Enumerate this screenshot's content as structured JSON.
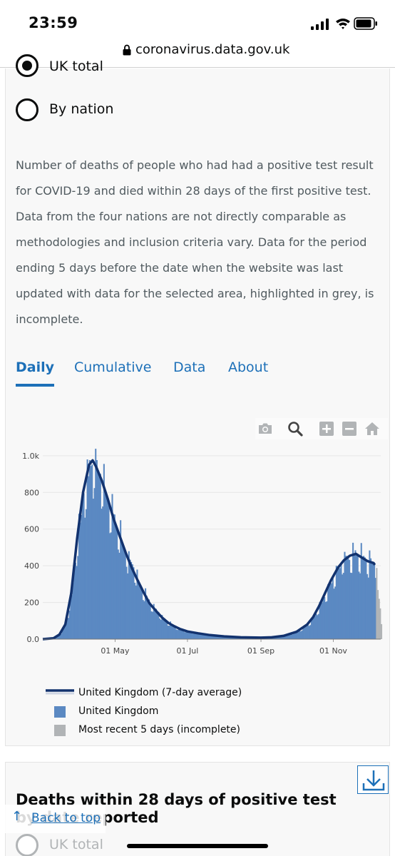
{
  "status_bar": {
    "time": "23:59"
  },
  "url_bar": {
    "url": "coronavirus.data.gov.uk"
  },
  "area_options": [
    {
      "label": "UK total",
      "checked": true
    },
    {
      "label": "By nation",
      "checked": false
    }
  ],
  "description": "Number of deaths of people who had had a positive test result for COVID-19 and died within 28 days of the first positive test. Data from the four nations are not directly comparable as methodologies and inclusion criteria vary. Data for the period ending 5 days before the date when the website was last updated with data for the selected area, highlighted in grey, is incomplete.",
  "tabs": [
    {
      "label": "Daily",
      "active": true
    },
    {
      "label": "Cumulative",
      "active": false
    },
    {
      "label": "Data",
      "active": false
    },
    {
      "label": "About",
      "active": false
    }
  ],
  "chart_toolbar": [
    "camera-icon",
    "zoom-icon",
    "zoom-in-icon",
    "zoom-out-icon",
    "home-icon"
  ],
  "chart_data": {
    "type": "bar",
    "title": "",
    "xlabel": "",
    "ylabel": "",
    "x_range": [
      "2020-03-01",
      "2020-12-11"
    ],
    "ylim": [
      0,
      1050
    ],
    "yticks": [
      "0.0",
      "200",
      "400",
      "600",
      "800",
      "1.0k"
    ],
    "xticks": [
      "01 May",
      "01 Jul",
      "01 Sep",
      "01 Nov"
    ],
    "grid": true,
    "legend_position": "bottom-left",
    "colors": {
      "average": "#12326e",
      "daily": "#5b89c2",
      "incomplete": "#b1b4b6"
    },
    "series": [
      {
        "name": "United Kingdom (7-day average)",
        "type": "line",
        "points": [
          [
            "2020-03-01",
            0
          ],
          [
            "2020-03-10",
            5
          ],
          [
            "2020-03-15",
            25
          ],
          [
            "2020-03-20",
            80
          ],
          [
            "2020-03-25",
            250
          ],
          [
            "2020-03-30",
            550
          ],
          [
            "2020-04-04",
            800
          ],
          [
            "2020-04-09",
            950
          ],
          [
            "2020-04-12",
            975
          ],
          [
            "2020-04-15",
            940
          ],
          [
            "2020-04-20",
            860
          ],
          [
            "2020-04-25",
            760
          ],
          [
            "2020-04-30",
            650
          ],
          [
            "2020-05-05",
            560
          ],
          [
            "2020-05-10",
            470
          ],
          [
            "2020-05-15",
            390
          ],
          [
            "2020-05-20",
            320
          ],
          [
            "2020-05-25",
            255
          ],
          [
            "2020-05-30",
            195
          ],
          [
            "2020-06-05",
            150
          ],
          [
            "2020-06-10",
            115
          ],
          [
            "2020-06-15",
            88
          ],
          [
            "2020-06-20",
            70
          ],
          [
            "2020-06-25",
            55
          ],
          [
            "2020-07-01",
            42
          ],
          [
            "2020-07-10",
            32
          ],
          [
            "2020-07-20",
            22
          ],
          [
            "2020-08-01",
            15
          ],
          [
            "2020-08-15",
            10
          ],
          [
            "2020-09-01",
            8
          ],
          [
            "2020-09-10",
            10
          ],
          [
            "2020-09-20",
            18
          ],
          [
            "2020-10-01",
            40
          ],
          [
            "2020-10-10",
            80
          ],
          [
            "2020-10-15",
            120
          ],
          [
            "2020-10-20",
            180
          ],
          [
            "2020-10-25",
            250
          ],
          [
            "2020-10-30",
            320
          ],
          [
            "2020-11-05",
            390
          ],
          [
            "2020-11-10",
            430
          ],
          [
            "2020-11-15",
            455
          ],
          [
            "2020-11-20",
            465
          ],
          [
            "2020-11-25",
            445
          ],
          [
            "2020-11-30",
            425
          ],
          [
            "2020-12-05",
            415
          ],
          [
            "2020-12-06",
            405
          ]
        ]
      },
      {
        "name": "United Kingdom",
        "type": "bar"
      },
      {
        "name": "Most recent 5 days (incomplete)",
        "type": "bar"
      }
    ]
  },
  "second_card": {
    "title": "Deaths within 28 days of positive test by date reported",
    "option": "UK total",
    "download_icon": "download-icon"
  },
  "back_to_top": "Back to top"
}
